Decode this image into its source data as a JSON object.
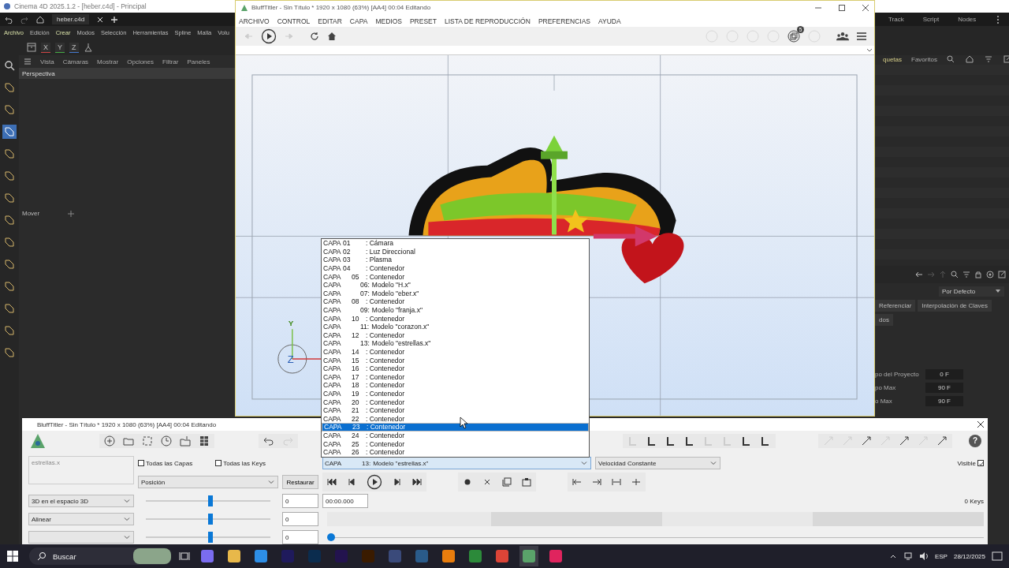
{
  "c4d": {
    "title": "Cinema 4D 2025.1.2 - [heber.c4d] - Principal",
    "tab": "heber.c4d",
    "menu": [
      "Archivo",
      "Edición",
      "Crear",
      "Modos",
      "Selección",
      "Herramientas",
      "Spline",
      "Malla",
      "Volu"
    ],
    "axis_buttons": [
      "X",
      "Y",
      "Z"
    ],
    "viewport_menu": [
      "Vista",
      "Cámaras",
      "Mostrar",
      "Opciones",
      "Filtrar",
      "Paneles"
    ],
    "viewport_title": "Perspectiva",
    "tool_label": "Mover",
    "layout_tabs": [
      "Track",
      "Script",
      "Nodes"
    ],
    "browser_tabs": [
      "quetas",
      "Favoritos"
    ],
    "preset": "Por Defecto",
    "buttons": [
      "Referenciar",
      "Interpolación de Claves",
      "dos"
    ],
    "fields": [
      {
        "label": "po del Proyecto",
        "value": "0 F"
      },
      {
        "label": "po Max",
        "value": "90 F"
      },
      {
        "label": "o Max",
        "value": "90 F"
      }
    ]
  },
  "canvas": {
    "axis_labels": [
      "Y",
      "Z"
    ]
  },
  "main_window": {
    "title": "BluffTitler - Sin Título * 1920 x 1080 (63%) [AA4] 00:04 Editando",
    "menu": [
      "ARCHIVO",
      "CONTROL",
      "EDITAR",
      "CAPA",
      "MEDIOS",
      "PRESET",
      "LISTA DE REPRODUCCIÓN",
      "PREFERENCIAS",
      "AYUDA"
    ],
    "badge": "5"
  },
  "layer_list": {
    "items": [
      {
        "kind": "top",
        "prefix": "CAPA",
        "number": "01",
        "name": ": Cámara",
        "selected": false
      },
      {
        "kind": "top",
        "prefix": "CAPA",
        "number": "02",
        "name": ": Luz Direccional",
        "selected": false
      },
      {
        "kind": "top",
        "prefix": "CAPA",
        "number": "03",
        "name": ": Plasma",
        "selected": false
      },
      {
        "kind": "top",
        "prefix": "CAPA",
        "number": "04",
        "name": ": Contenedor",
        "selected": false
      },
      {
        "kind": "container",
        "prefix": "CAPA",
        "number": "05",
        "name": ": Contenedor",
        "selected": false
      },
      {
        "kind": "model",
        "prefix": "CAPA",
        "number": "06:",
        "name": "Modelo \"H.x\"",
        "selected": false
      },
      {
        "kind": "model",
        "prefix": "CAPA",
        "number": "07:",
        "name": "Modelo \"eber.x\"",
        "selected": false
      },
      {
        "kind": "container",
        "prefix": "CAPA",
        "number": "08",
        "name": ": Contenedor",
        "selected": false
      },
      {
        "kind": "model",
        "prefix": "CAPA",
        "number": "09:",
        "name": "Modelo \"franja.x\"",
        "selected": false
      },
      {
        "kind": "container",
        "prefix": "CAPA",
        "number": "10",
        "name": ": Contenedor",
        "selected": false
      },
      {
        "kind": "model",
        "prefix": "CAPA",
        "number": "11:",
        "name": "Modelo \"corazon.x\"",
        "selected": false
      },
      {
        "kind": "container",
        "prefix": "CAPA",
        "number": "12",
        "name": ": Contenedor",
        "selected": false
      },
      {
        "kind": "model",
        "prefix": "CAPA",
        "number": "13:",
        "name": "Modelo \"estrellas.x\"",
        "selected": false
      },
      {
        "kind": "container",
        "prefix": "CAPA",
        "number": "14",
        "name": ": Contenedor",
        "selected": false
      },
      {
        "kind": "container",
        "prefix": "CAPA",
        "number": "15",
        "name": ": Contenedor",
        "selected": false
      },
      {
        "kind": "container",
        "prefix": "CAPA",
        "number": "16",
        "name": ": Contenedor",
        "selected": false
      },
      {
        "kind": "container",
        "prefix": "CAPA",
        "number": "17",
        "name": ": Contenedor",
        "selected": false
      },
      {
        "kind": "container",
        "prefix": "CAPA",
        "number": "18",
        "name": ": Contenedor",
        "selected": false
      },
      {
        "kind": "container",
        "prefix": "CAPA",
        "number": "19",
        "name": ": Contenedor",
        "selected": false
      },
      {
        "kind": "container",
        "prefix": "CAPA",
        "number": "20",
        "name": ": Contenedor",
        "selected": false
      },
      {
        "kind": "container",
        "prefix": "CAPA",
        "number": "21",
        "name": ": Contenedor",
        "selected": false
      },
      {
        "kind": "container",
        "prefix": "CAPA",
        "number": "22",
        "name": ": Contenedor",
        "selected": false
      },
      {
        "kind": "container",
        "prefix": "CAPA",
        "number": "23",
        "name": ": Contenedor",
        "selected": true
      },
      {
        "kind": "container",
        "prefix": "CAPA",
        "number": "24",
        "name": ": Contenedor",
        "selected": false
      },
      {
        "kind": "container",
        "prefix": "CAPA",
        "number": "25",
        "name": ": Contenedor",
        "selected": false
      },
      {
        "kind": "container",
        "prefix": "CAPA",
        "number": "26",
        "name": ": Contenedor",
        "selected": false
      }
    ]
  },
  "panel": {
    "title": "BluffTitler - Sin Título * 1920 x 1080 (63%) [AA4] 00:04 Editando",
    "name_field": "estrellas.x",
    "checks": [
      {
        "label": "Todas las Capas",
        "checked": false
      },
      {
        "label": "Todas las Keys",
        "checked": false
      }
    ],
    "property": "Posición",
    "restore": "Restaurar",
    "layer": {
      "prefix": "CAPA",
      "number": "13:",
      "name": "Modelo \"estrellas.x\""
    },
    "interpolation": "Velocidad Constante",
    "visible": {
      "label": "Visible",
      "checked": true
    },
    "sliders": [
      {
        "mode": "3D en el espacio 3D",
        "level": 0.52,
        "value": "0"
      },
      {
        "mode": "Alinear",
        "level": 0.52,
        "value": "0"
      },
      {
        "level": 0.52,
        "value": "0"
      }
    ],
    "time": "00:00.000",
    "keys": "0 Keys",
    "help": "?"
  },
  "taskbar": {
    "search": "Buscar",
    "language": "ESP",
    "date": "28/12/2025"
  }
}
